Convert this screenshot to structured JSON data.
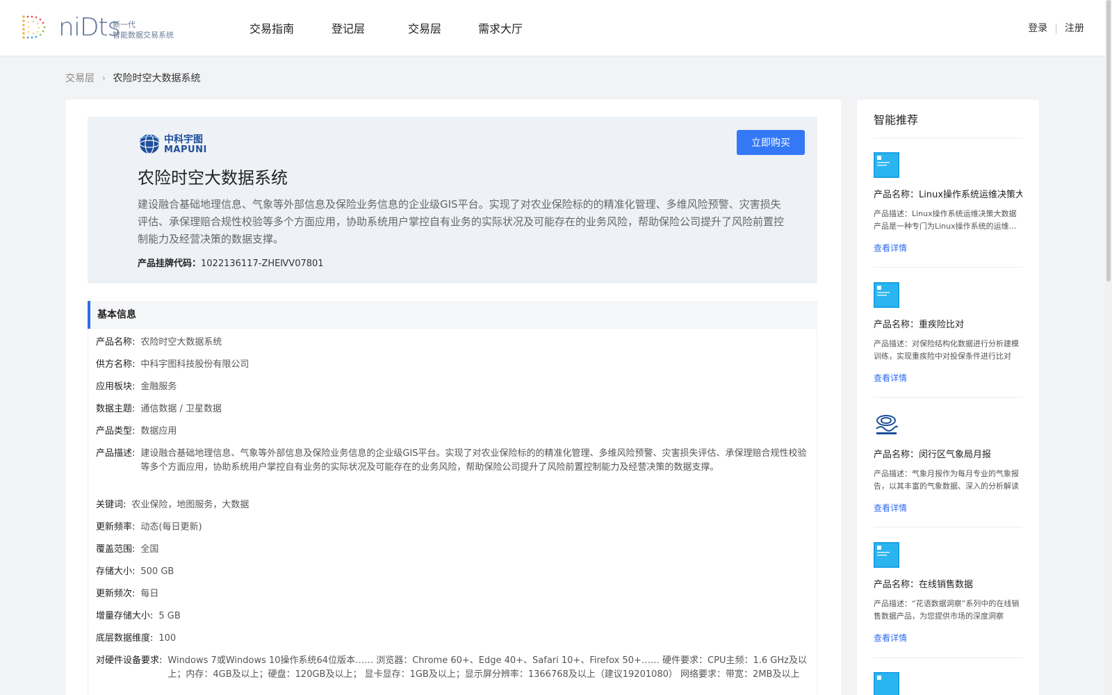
{
  "header": {
    "logo_text": "niDts",
    "logo_sub_line1": "新一代",
    "logo_sub_line2": "智能数据交易系统",
    "nav": [
      "交易指南",
      "登记层",
      "交易层",
      "需求大厅"
    ],
    "login": "登录",
    "register": "注册"
  },
  "breadcrumb": {
    "parent": "交易层",
    "current": "农险时空大数据系统"
  },
  "hero": {
    "supplier_logo_cn": "中科宇图",
    "supplier_logo_en": "MAPUNI",
    "buy_label": "立即购买",
    "title": "农险时空大数据系统",
    "description": "建设融合基础地理信息、气象等外部信息及保险业务信息的企业级GIS平台。实现了对农业保险标的的精准化管理、多维风险预警、灾害损失评估、承保理赔合规性校验等多个方面应用，协助系统用户掌控自有业务的实际状况及可能存在的业务风险，帮助保险公司提升了风险前置控制能力及经营决策的数据支撑。",
    "code_label": "产品挂牌代码：",
    "code_value": "1022136117-ZHEⅣV07801"
  },
  "basic_info": {
    "section_title": "基本信息",
    "rows": [
      {
        "k": "产品名称:",
        "v": "农险时空大数据系统"
      },
      {
        "k": "供方名称:",
        "v": "中科宇图科技股份有限公司"
      },
      {
        "k": "应用板块:",
        "v": "金融服务"
      },
      {
        "k": "数据主题:",
        "v": "通信数据 / 卫星数据"
      },
      {
        "k": "产品类型:",
        "v": "数据应用"
      },
      {
        "k": "产品描述:",
        "v": "建设融合基础地理信息、气象等外部信息及保险业务信息的企业级GIS平台。实现了对农业保险标的的精准化管理、多维风险预警、灾害损失评估、承保理赔合规性校验等多个方面应用，协助系统用户掌控自有业务的实际状况及可能存在的业务风险，帮助保险公司提升了风险前置控制能力及经营决策的数据支撑。"
      },
      {
        "k": "关键词:",
        "v": "农业保险，地图服务，大数据"
      },
      {
        "k": "更新频率:",
        "v": "动态(每日更新)"
      },
      {
        "k": "覆盖范围:",
        "v": "全国"
      },
      {
        "k": "存储大小:",
        "v": "500 GB"
      },
      {
        "k": "更新频次:",
        "v": "每日"
      },
      {
        "k": "增量存储大小:",
        "v": "5 GB"
      },
      {
        "k": "底层数据维度:",
        "v": "100"
      },
      {
        "k": "对硬件设备要求:",
        "v": "Windows 7或Windows 10操作系统64位版本…… 浏览器：Chrome 60+、Edge 40+、Safari 10+、Firefox 50+…… 硬件要求：CPU主频：1.6 GHz及以上；内存：4GB及以上；硬盘：120GB及以上； 显卡显存：1GB及以上；显示屏分辨率：1366768及以上（建议19201080） 网络要求：带宽：2MB及以上"
      }
    ]
  },
  "sidebar": {
    "title": "智能推荐",
    "items": [
      {
        "name": "产品名称：Linux操作系统运维决策大数据",
        "desc": "产品描述：Linux操作系统运维决策大数据产品是一种专门为Linux操作系统的运维提供决策支持的大数据产品",
        "link": "查看详情"
      },
      {
        "name": "产品名称：重疾险比对",
        "desc": "产品描述：对保险结构化数据进行分析建模训练，实现重疾险中对投保条件进行比对",
        "link": "查看详情"
      },
      {
        "name": "产品名称：闵行区气象局月报",
        "desc": "产品描述：气象月报作为每月专业的气象报告，以其丰富的气象数据、深入的分析解读",
        "link": "查看详情"
      },
      {
        "name": "产品名称：在线销售数据",
        "desc": "产品描述：“花语数据洞察”系列中的在线销售数据产品，为您提供市场的深度洞察",
        "link": "查看详情"
      }
    ]
  }
}
